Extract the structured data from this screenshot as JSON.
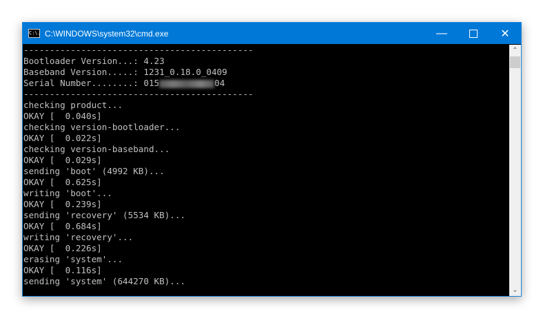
{
  "window": {
    "title": "C:\\WINDOWS\\system32\\cmd.exe",
    "icon": "cmd-icon",
    "icon_text": "C:\\."
  },
  "controls": {
    "minimize": "—",
    "maximize": "maximize-icon",
    "close": "✕"
  },
  "scrollbar": {
    "up": "⌃",
    "down": "⌄"
  },
  "console": {
    "lines": [
      "--------------------------------------------",
      "Bootloader Version...: 4.23",
      "Baseband Version.....: 1231_0.18.0_0409",
      "",
      "--------------------------------------------",
      "checking product...",
      "OKAY [  0.040s]",
      "checking version-bootloader...",
      "OKAY [  0.022s]",
      "checking version-baseband...",
      "OKAY [  0.029s]",
      "sending 'boot' (4992 KB)...",
      "OKAY [  0.625s]",
      "writing 'boot'...",
      "OKAY [  0.239s]",
      "sending 'recovery' (5534 KB)...",
      "OKAY [  0.684s]",
      "writing 'recovery'...",
      "OKAY [  0.226s]",
      "erasing 'system'...",
      "OKAY [  0.116s]",
      "sending 'system' (644270 KB)..."
    ],
    "serial": {
      "label": "Serial Number........: ",
      "prefix": "015",
      "suffix": "04"
    }
  }
}
